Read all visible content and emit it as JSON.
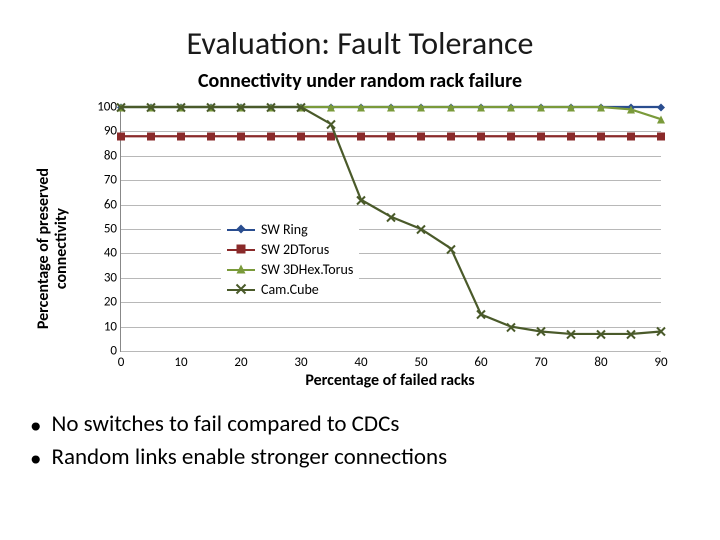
{
  "title": "Evaluation: Fault Tolerance",
  "subtitle": "Connectivity under random rack failure",
  "bullets": [
    "No switches to fail compared to CDCs",
    "Random links enable stronger connections"
  ],
  "chart_data": {
    "type": "line",
    "title": "Connectivity under random rack failure",
    "xlabel": "Percentage of failed racks",
    "ylabel": "Percentage of preserved\nconnectivity",
    "xlim": [
      0,
      90
    ],
    "ylim": [
      0,
      100
    ],
    "xticks": [
      0,
      10,
      20,
      30,
      40,
      50,
      60,
      70,
      80,
      90
    ],
    "yticks": [
      0,
      10,
      20,
      30,
      40,
      50,
      60,
      70,
      80,
      90,
      100
    ],
    "x": [
      0,
      5,
      10,
      15,
      20,
      25,
      30,
      35,
      40,
      45,
      50,
      55,
      60,
      65,
      70,
      75,
      80,
      85,
      90
    ],
    "series": [
      {
        "name": "SW Ring",
        "color": "#2a4d8f",
        "marker": "diamond",
        "values": [
          100,
          100,
          100,
          100,
          100,
          100,
          100,
          100,
          100,
          100,
          100,
          100,
          100,
          100,
          100,
          100,
          100,
          100,
          100
        ]
      },
      {
        "name": "SW 2DTorus",
        "color": "#8a2a2a",
        "marker": "square",
        "values": [
          88,
          88,
          88,
          88,
          88,
          88,
          88,
          88,
          88,
          88,
          88,
          88,
          88,
          88,
          88,
          88,
          88,
          88,
          88
        ]
      },
      {
        "name": "SW 3DHex.Torus",
        "color": "#7a9a3a",
        "marker": "triangle",
        "values": [
          100,
          100,
          100,
          100,
          100,
          100,
          100,
          100,
          100,
          100,
          100,
          100,
          100,
          100,
          100,
          100,
          100,
          99,
          95
        ]
      },
      {
        "name": "Cam.Cube",
        "color": "#4a5a2a",
        "marker": "x",
        "values": [
          100,
          100,
          100,
          100,
          100,
          100,
          100,
          93,
          62,
          55,
          50,
          42,
          15,
          10,
          8,
          7,
          7,
          7,
          8
        ]
      }
    ],
    "legend_position": "inside-lower-left"
  }
}
